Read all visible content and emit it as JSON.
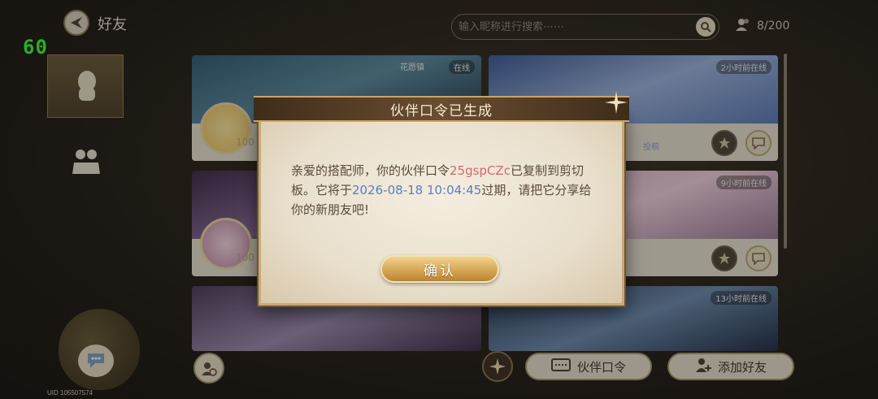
{
  "fps": "60",
  "header": {
    "title": "好友",
    "search_placeholder": "输入昵称进行搜索⋯⋯",
    "friend_count": "8/200"
  },
  "cards": [
    {
      "status": "在线",
      "tag": "花愿镇",
      "level": "100"
    },
    {
      "status": "2小时前在线",
      "sub": "投稿"
    },
    {
      "status": "",
      "level": "100"
    },
    {
      "status": "9小时前在线"
    },
    {
      "status": ""
    },
    {
      "status": "13小时前在线"
    }
  ],
  "bottom": {
    "partner_code_label": "伙伴口令",
    "add_friend_label": "添加好友"
  },
  "uid": "UID 105507574",
  "modal": {
    "title": "伙伴口令已生成",
    "text_1": "亲爱的搭配师，你的伙伴口令",
    "code": "25gspCZc",
    "text_2": "已复制到剪切板。它将于",
    "expiry": "2026-08-18 10:04:45",
    "text_3": "过期，请把它分享给你的新朋友吧!",
    "confirm_label": "确认"
  },
  "colors": {
    "fps": "#39ff3a",
    "code": "#d46a6e",
    "expiry": "#5c7fb8",
    "confirm": "#d7a654"
  },
  "icons": [
    "back-logo-icon",
    "search-icon",
    "friends-icon",
    "avatar-silhouette-icon",
    "group-icon",
    "chat-icon",
    "block-user-icon",
    "visit-icon",
    "ticket-icon",
    "add-user-icon",
    "star-ornament-icon"
  ]
}
